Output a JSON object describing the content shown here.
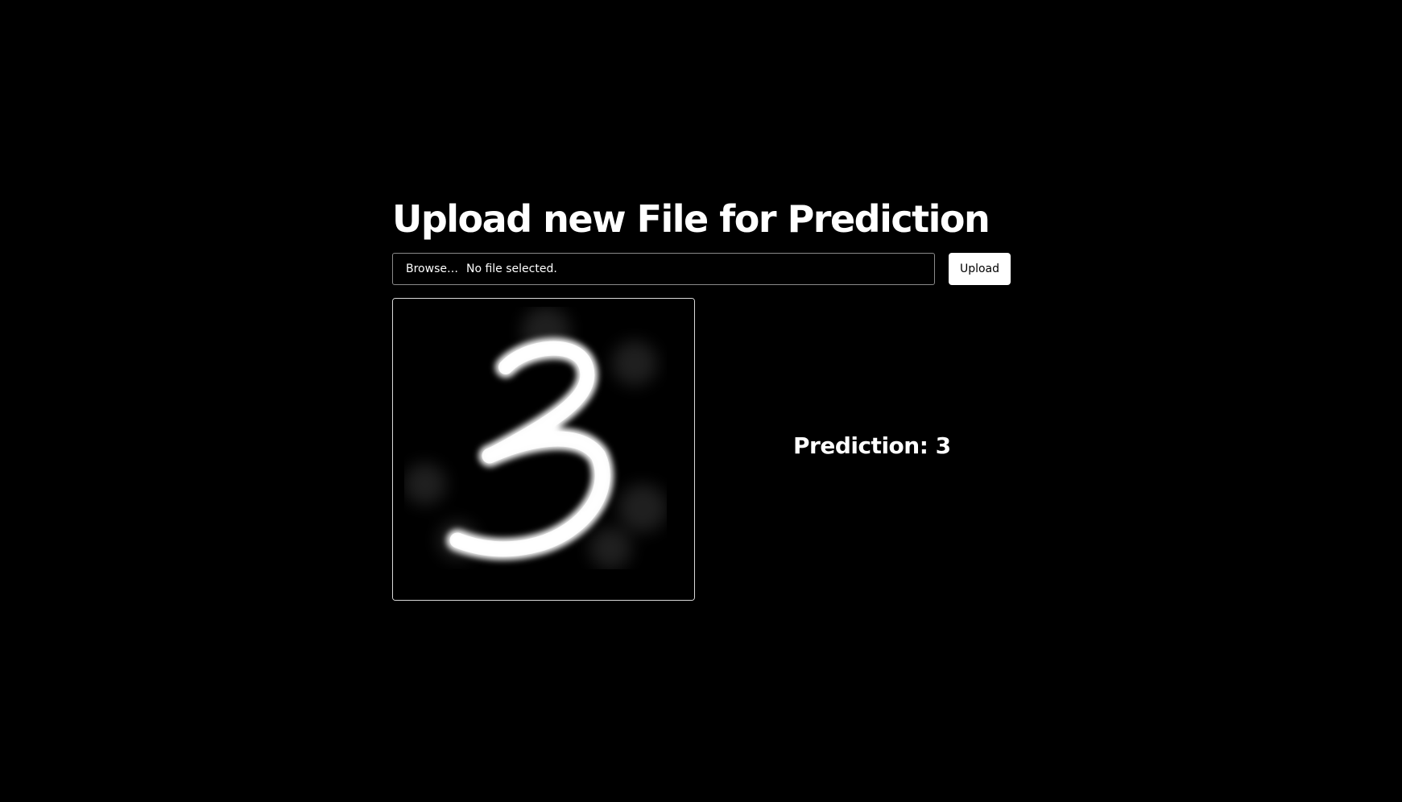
{
  "page": {
    "title": "Upload new File for Prediction"
  },
  "upload_form": {
    "browse_label": "Browse…",
    "file_status": "No file selected.",
    "upload_label": "Upload"
  },
  "preview": {
    "image_description": "handwritten-digit-image"
  },
  "result": {
    "prediction_text": "Prediction: 3"
  },
  "colors": {
    "background": "#000000",
    "text": "#ffffff",
    "button_background": "#ffffff",
    "button_text": "#000000",
    "input_border": "#8a8a8a"
  }
}
